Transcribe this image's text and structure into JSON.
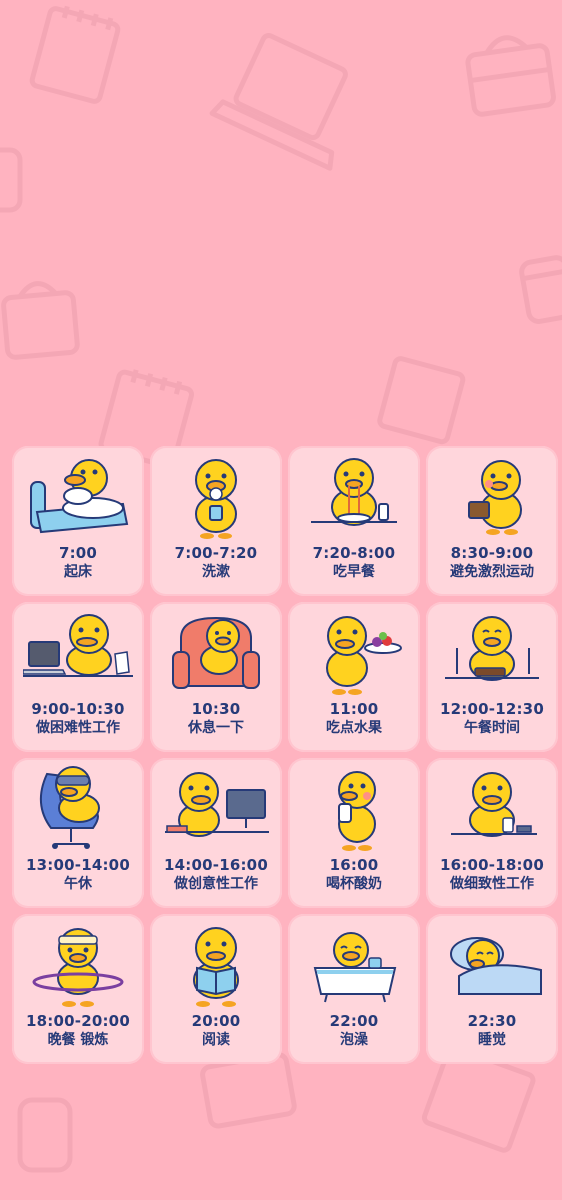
{
  "colors": {
    "background": "#ffb3c0",
    "card": "#ffd6dc",
    "text": "#263a78",
    "duck": "#ffd21f",
    "beak": "#f5a422"
  },
  "schedule": [
    {
      "time": "7:00",
      "label": "起床",
      "icon": "duck-in-bed-icon"
    },
    {
      "time": "7:00-7:20",
      "label": "洗漱",
      "icon": "duck-brushing-teeth-icon"
    },
    {
      "time": "7:20-8:00",
      "label": "吃早餐",
      "icon": "duck-eating-breakfast-icon"
    },
    {
      "time": "8:30-9:00",
      "label": "避免激烈运动",
      "icon": "duck-walking-with-bag-icon"
    },
    {
      "time": "9:00-10:30",
      "label": "做困难性工作",
      "icon": "duck-at-laptop-icon"
    },
    {
      "time": "10:30",
      "label": "休息一下",
      "icon": "duck-on-sofa-icon"
    },
    {
      "time": "11:00",
      "label": "吃点水果",
      "icon": "duck-with-fruit-plate-icon"
    },
    {
      "time": "12:00-12:30",
      "label": "午餐时间",
      "icon": "duck-lunch-icon"
    },
    {
      "time": "13:00-14:00",
      "label": "午休",
      "icon": "duck-napping-in-chair-icon"
    },
    {
      "time": "14:00-16:00",
      "label": "做创意性工作",
      "icon": "duck-at-computer-icon"
    },
    {
      "time": "16:00",
      "label": "喝杯酸奶",
      "icon": "duck-drinking-yogurt-icon"
    },
    {
      "time": "16:00-18:00",
      "label": "做细致性工作",
      "icon": "duck-detailed-work-icon"
    },
    {
      "time": "18:00-20:00",
      "label": "晚餐 锻炼",
      "icon": "duck-hula-hoop-icon"
    },
    {
      "time": "20:00",
      "label": "阅读",
      "icon": "duck-reading-book-icon"
    },
    {
      "time": "22:00",
      "label": "泡澡",
      "icon": "duck-in-bathtub-icon"
    },
    {
      "time": "22:30",
      "label": "睡觉",
      "icon": "duck-sleeping-icon"
    }
  ]
}
